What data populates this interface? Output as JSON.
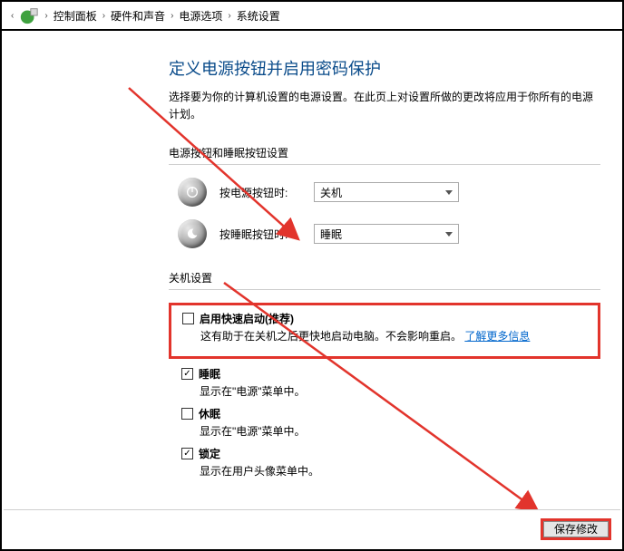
{
  "breadcrumb": {
    "items": [
      "控制面板",
      "硬件和声音",
      "电源选项",
      "系统设置"
    ]
  },
  "page": {
    "title": "定义电源按钮并启用密码保护",
    "desc": "选择要为你的计算机设置的电源设置。在此页上对设置所做的更改将应用于你所有的电源计划。"
  },
  "sectionButtons": {
    "title": "电源按钮和睡眠按钮设置",
    "power": {
      "label": "按电源按钮时:",
      "value": "关机"
    },
    "sleep": {
      "label": "按睡眠按钮时:",
      "value": "睡眠"
    }
  },
  "sectionShutdown": {
    "title": "关机设置",
    "fastStartup": {
      "label": "启用快速启动(推荐)",
      "desc": "这有助于在关机之后更快地启动电脑。不会影响重启。",
      "linkText": "了解更多信息",
      "checked": false
    },
    "sleep": {
      "label": "睡眠",
      "desc": "显示在\"电源\"菜单中。",
      "checked": true
    },
    "hibernate": {
      "label": "休眠",
      "desc": "显示在\"电源\"菜单中。",
      "checked": false
    },
    "lock": {
      "label": "锁定",
      "desc": "显示在用户头像菜单中。",
      "checked": true
    }
  },
  "footer": {
    "saveLabel": "保存修改"
  }
}
